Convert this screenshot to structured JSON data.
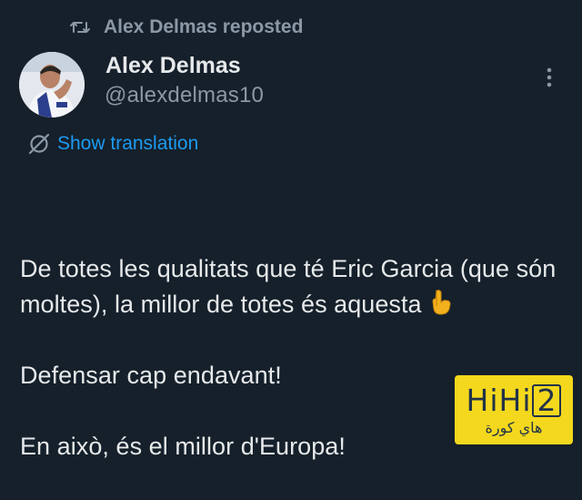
{
  "repost": {
    "label": "Alex Delmas reposted",
    "icon": "repost-icon"
  },
  "author": {
    "name": "Alex Delmas",
    "handle": "@alexdelmas10",
    "avatar_icon": "avatar-photo"
  },
  "menu": {
    "icon": "more-vertical-icon"
  },
  "translation": {
    "label": "Show translation",
    "icon": "translate-icon",
    "color": "#1d9bf0"
  },
  "tweet": {
    "line1": "De totes les qualitats que té Eric Garcia (que són moltes), la millor de totes és aquesta",
    "emoji": "👇",
    "line2": "Defensar cap endavant!",
    "line3": "En això, és el millor d'Europa!"
  },
  "watermark": {
    "brand": "HiHi",
    "brand_number": "2",
    "arabic": "هاي كورة",
    "background": "#f4d81d"
  },
  "colors": {
    "background": "#15202b",
    "text": "#e7e9ea",
    "secondary": "#8b98a5",
    "accent": "#1d9bf0"
  }
}
